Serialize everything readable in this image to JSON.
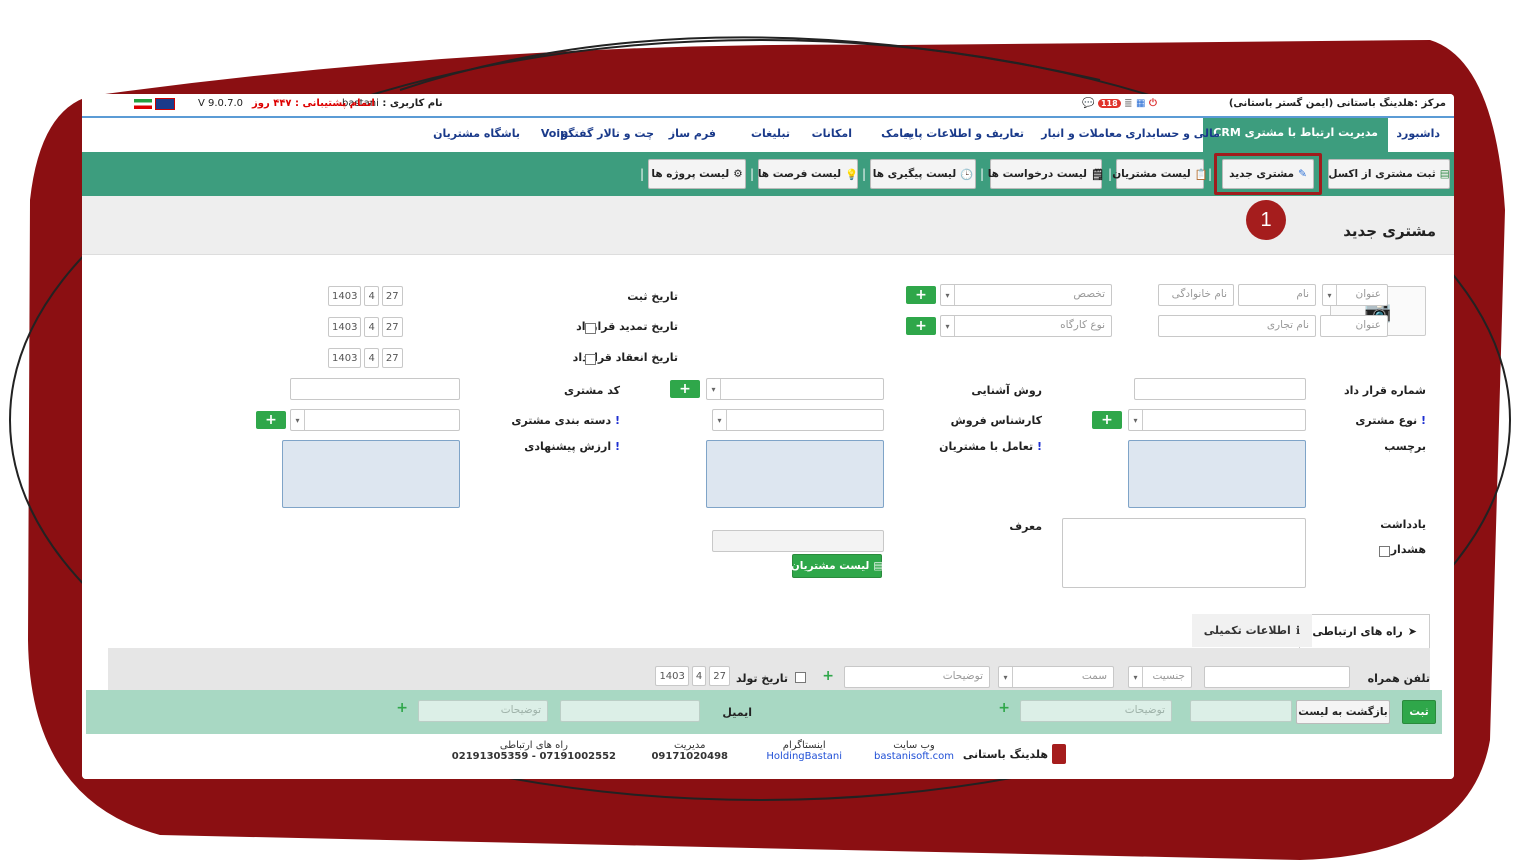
{
  "topbar": {
    "center": "مرکز :هلدینگ باستانی (ایمن گستر باستانی)",
    "user_label": "نام کاربری :",
    "user_value": "bastani",
    "support_label": "اتمام پشتیبانی :",
    "support_value": "۴۴۷ روز",
    "version": "V 9.0.7.0",
    "notif_count": "118"
  },
  "menu": {
    "items": [
      "داشبورد",
      "مدیریت ارتباط با مشتری CRM",
      "مالی و حسابداری",
      "معاملات و انبار",
      "تعاریف و اطلاعات پایه",
      "پیامک",
      "امکانات",
      "تبلیغات",
      "فرم ساز",
      "چت و تالار گفتگو",
      "Voip",
      "باشگاه مشتریان"
    ]
  },
  "toolbar": {
    "buttons": [
      "ثبت مشتری از اکسل",
      "مشتری جدید",
      "لیست مشتریان",
      "لیست درخواست ها",
      "لیست پیگیری ها",
      "لیست فرصت ها",
      "لیست پروژه ها"
    ]
  },
  "callout": "1",
  "page_title": "مشتری جدید",
  "form": {
    "title_ph": "عنوان",
    "firstname_ph": "نام",
    "lastname_ph": "نام خانوادگی",
    "title2_ph": "عنوان",
    "tradename_ph": "نام تجاری",
    "specialty_ph": "تخصص",
    "workshop_ph": "نوع کارگاه",
    "reg_date": "تاریخ ثبت",
    "renew_date": "تاریخ تمدید قرارداد",
    "contract_date": "تاریخ انعقاد قرارداد",
    "date_year": "1403",
    "date_month": "4",
    "date_day": "27",
    "contract_no": "شماره قرار داد",
    "acquaint": "روش آشنایی",
    "customer_code": "کد مشتری",
    "customer_type": "نوع مشتری",
    "sales_expert": "کارشناس فروش",
    "customer_category": "دسته بندی مشتری",
    "tag": "برچسب",
    "interaction": "تعامل با مشتریان",
    "offer_value": "ارزش پیشنهادی",
    "note": "یادداشت",
    "warning": "هشدار",
    "referrer": "معرف",
    "customer_list_btn": "لیست مشتریان"
  },
  "tabs": {
    "contacts": "راه های ارتباطی",
    "extra": "اطلاعات تکمیلی"
  },
  "contact_row": {
    "mobile": "تلفن همراه",
    "gender_ph": "جنسیت",
    "position_ph": "سمت",
    "desc_ph": "توضیحات",
    "birth": "تاریخ تولد",
    "email": "ایمیل"
  },
  "actions": {
    "save": "ثبت",
    "back": "بازگشت به لیست"
  },
  "footer": {
    "brand": "هلدینگ باستانی",
    "website_h": "وب سایت",
    "website_v": "bastanisoft.com",
    "instagram_h": "اینستاگرام",
    "instagram_v": "HoldingBastani",
    "manager_h": "مدیریت",
    "manager_v": "09171020498",
    "contact_h": "راه های ارتباطی",
    "contact_v": "07191002552 - 02191305359"
  },
  "colors": {
    "accent": "#3d9d7e",
    "frame": "#8b0f12",
    "plus": "#2fa74a",
    "callout": "#a51d1d"
  }
}
